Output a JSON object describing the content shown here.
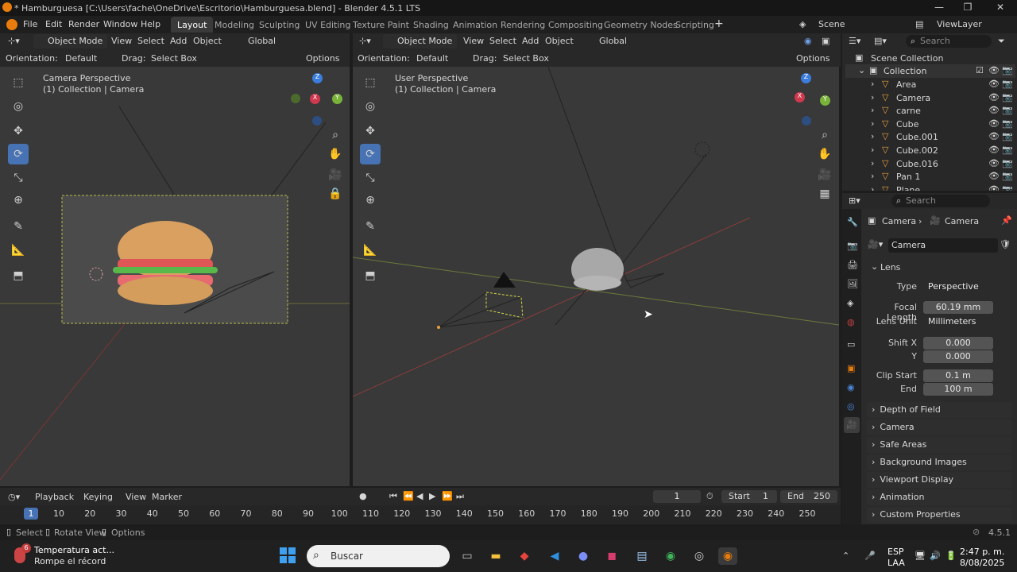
{
  "title": "* Hamburguesa [C:\\Users\\fache\\OneDrive\\Escritorio\\Hamburguesa.blend] - Blender 4.5.1 LTS",
  "menu": [
    "File",
    "Edit",
    "Render",
    "Window",
    "Help"
  ],
  "workspaces": [
    "Layout",
    "Modeling",
    "Sculpting",
    "UV Editing",
    "Texture Paint",
    "Shading",
    "Animation",
    "Rendering",
    "Compositing",
    "Geometry Nodes",
    "Scripting"
  ],
  "scene": "Scene",
  "view_layer": "ViewLayer",
  "left_vp": {
    "mode": "Object Mode",
    "menus": [
      "View",
      "Select",
      "Add",
      "Object"
    ],
    "transform": "Global",
    "orientation_label": "Orientation:",
    "orientation": "Default",
    "drag_label": "Drag:",
    "drag": "Select Box",
    "options": "Options",
    "title": "Camera Perspective",
    "subtitle": "(1) Collection | Camera"
  },
  "right_vp": {
    "mode": "Object Mode",
    "menus": [
      "View",
      "Select",
      "Add",
      "Object"
    ],
    "transform": "Global",
    "orientation_label": "Orientation:",
    "orientation": "Default",
    "drag_label": "Drag:",
    "drag": "Select Box",
    "options": "Options",
    "title": "User Perspective",
    "subtitle": "(1) Collection | Camera"
  },
  "outliner": {
    "search": "Search",
    "scene_collection": "Scene Collection",
    "collection": "Collection",
    "items": [
      "Area",
      "Camera",
      "carne",
      "Cube",
      "Cube.001",
      "Cube.002",
      "Cube.016",
      "Pan 1",
      "Plane"
    ]
  },
  "props": {
    "search": "Search",
    "breadcrumb_a": "Camera",
    "breadcrumb_b": "Camera",
    "data_name": "Camera",
    "lens": "Lens",
    "type_label": "Type",
    "type": "Perspective",
    "focal_label": "Focal Length",
    "focal": "60.19 mm",
    "unit_label": "Lens Unit",
    "unit": "Millimeters",
    "shiftx_label": "Shift X",
    "shiftx": "0.000",
    "shifty_label": "Y",
    "shifty": "0.000",
    "clipstart_label": "Clip Start",
    "clipstart": "0.1 m",
    "clipend_label": "End",
    "clipend": "100 m",
    "panels": [
      "Depth of Field",
      "Camera",
      "Safe Areas",
      "Background Images",
      "Viewport Display",
      "Animation",
      "Custom Properties"
    ]
  },
  "timeline": {
    "menus": [
      "Playback",
      "Keying",
      "View",
      "Marker"
    ],
    "frame": "1",
    "start_label": "Start",
    "start": "1",
    "end_label": "End",
    "end": "250",
    "current": "1",
    "ticks": [
      "10",
      "20",
      "30",
      "40",
      "50",
      "60",
      "70",
      "80",
      "90",
      "100",
      "110",
      "120",
      "130",
      "140",
      "150",
      "160",
      "170",
      "180",
      "190",
      "200",
      "210",
      "220",
      "230",
      "240",
      "250"
    ]
  },
  "status": {
    "select": "Select",
    "rotate": "Rotate View",
    "options": "Options",
    "version": "4.5.1"
  },
  "taskbar": {
    "weather_title": "Temperatura act...",
    "weather_sub": "Rompe el récord",
    "badge": "6",
    "search": "Buscar",
    "lang1": "ESP",
    "lang2": "LAA",
    "time": "2:47 p. m.",
    "date": "8/08/2025"
  }
}
